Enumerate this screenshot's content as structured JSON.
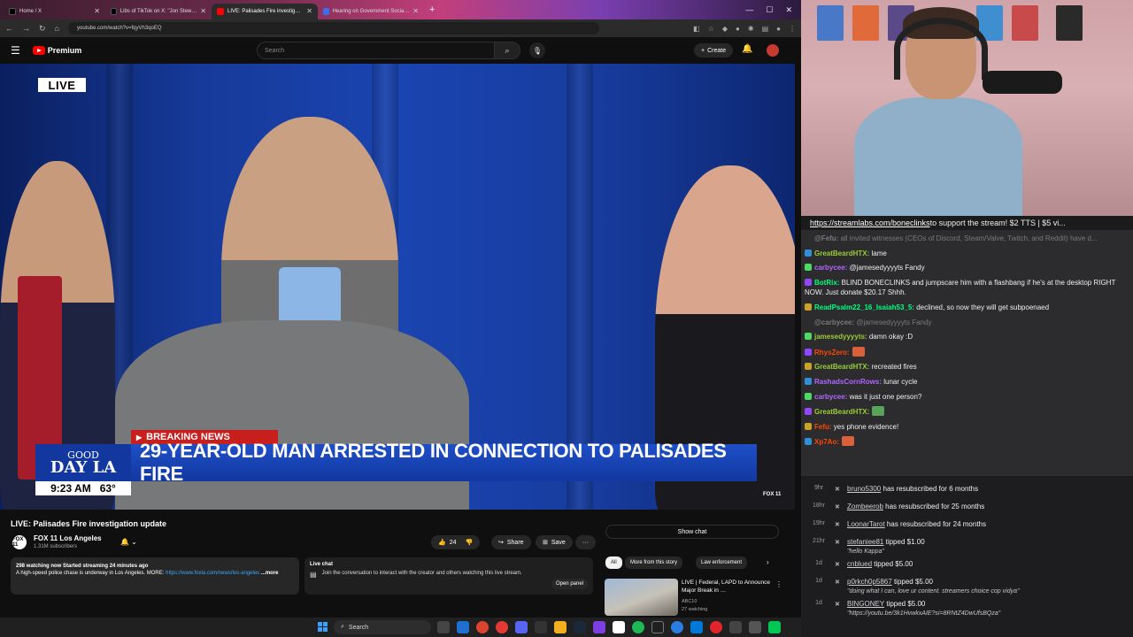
{
  "browser": {
    "tabs": [
      {
        "label": "Home / X"
      },
      {
        "label": "Libs of TikTok on X: \"Jon Stew…"
      },
      {
        "label": "LIVE: Palisades Fire investig…"
      },
      {
        "label": "Hearing on Government Socia…"
      }
    ],
    "url": "youtube.com/watch?v=fqyVh3qoEQ"
  },
  "youtube": {
    "logo": "Premium",
    "search_placeholder": "Search",
    "create_label": "Create",
    "video": {
      "live_badge": "LIVE",
      "breaking": "BREAKING NEWS",
      "headline": "29-YEAR-OLD MAN ARRESTED IN CONNECTION TO PALISADES FIRE",
      "show_line1": "GOOD",
      "show_line2": "DAY LA",
      "time": "9:23 AM",
      "temp": "63°",
      "bug": "FOX 11"
    },
    "title": "LIVE: Palisades Fire investigation update",
    "channel": {
      "name": "FOX 11 Los Angeles",
      "subs": "1.31M subscribers",
      "logo": "FOX 11"
    },
    "actions": {
      "likes": "24",
      "share": "Share",
      "save": "Save",
      "more": "···"
    },
    "description": {
      "stats": "298 watching now  Started streaming 24 minutes ago",
      "text": "A high-speed police chase is underway in Los Angeles. MORE:",
      "link": "https://www.foxla.com/news/los-angeles",
      "more": "...more"
    },
    "live_chat": {
      "header": "Live chat",
      "text": "Join the conversation to interact with the creator and others watching this live stream.",
      "open_panel": "Open panel"
    },
    "show_chat": "Show chat",
    "chips": [
      "All",
      "More from this story",
      "Law enforcement"
    ],
    "recommended": {
      "title": "LIVE | Federal, LAPD to Announce Major Break in …",
      "channel": "ABC10",
      "views": "27 watching"
    }
  },
  "taskbar": {
    "search": "Search"
  },
  "stream": {
    "link_text": "https://streamlabs.com/boneclinks",
    "link_rest": " to support the stream! $2 TTS | $5 vi..."
  },
  "chat": [
    {
      "user": "@Fefu:",
      "text": " all invited witnesses (CEOs of Discord, Steam/Valve, Twitch, and Reddit) have d...",
      "color": "#7a7a7e",
      "dim": true
    },
    {
      "user": "GreatBeardHTX:",
      "text": " lame",
      "color": "#9acd32"
    },
    {
      "user": "carbycee:",
      "text": " @jamesedyyyyts Fandy",
      "color": "#b066ff"
    },
    {
      "user": "BotRix:",
      "text": " BLIND BONECLINKS and jumpscare him with a flashbang if he's at the desktop RIGHT NOW. Just donate $20.17 Shhh.",
      "color": "#00ff7f"
    },
    {
      "user": "ReadPsalm22_16_Isaiah53_5:",
      "text": " declined, so now they will get subpoenaed",
      "color": "#00ff7f"
    },
    {
      "user": "@carbycee:",
      "text": " @jamesedyyyyts Fandy",
      "color": "#7a7a7e",
      "dim": true
    },
    {
      "user": "jamesedyyyyts:",
      "text": " damn okay :D",
      "color": "#9acd32"
    },
    {
      "user": "RhysZero:",
      "text": "",
      "color": "#ff4500"
    },
    {
      "user": "GreatBeardHTX:",
      "text": " recreated fires",
      "color": "#9acd32"
    },
    {
      "user": "RashadsCornRows:",
      "text": " lunar cycle",
      "color": "#b066ff"
    },
    {
      "user": "carbycee:",
      "text": " was it just one person?",
      "color": "#b066ff"
    },
    {
      "user": "GreatBeardHTX:",
      "text": "",
      "color": "#9acd32"
    },
    {
      "user": "Fefu:",
      "text": " yes phone evidence!",
      "color": "#ff4500"
    },
    {
      "user": "Xp7Ao:",
      "text": "",
      "color": "#ff4500"
    }
  ],
  "events": [
    {
      "age": "9hr",
      "user": "bruno5300",
      "action": " has resubscribed for 6 months",
      "note": ""
    },
    {
      "age": "18hr",
      "user": "Zombeerob",
      "action": " has resubscribed for 25 months",
      "note": ""
    },
    {
      "age": "19hr",
      "user": "LoonarTarot",
      "action": " has resubscribed for 24 months",
      "note": ""
    },
    {
      "age": "21hr",
      "user": "stefaniee81",
      "action": " tipped $1.00",
      "note": "\"hello Kappa\""
    },
    {
      "age": "1d",
      "user": "cnblued",
      "action": " tipped $5.00",
      "note": ""
    },
    {
      "age": "1d",
      "user": "p0rkch0p5867",
      "action": " tipped $5.00",
      "note": "\"doing what I can, love ur content. streamers choice cop vidya\""
    },
    {
      "age": "1d",
      "user": "BINGONEY",
      "action": " tipped $5.00",
      "note": "\"https://youtu.be/3k1HvwkxAIE?si=8RNtZ4DwUfsBQza\""
    }
  ]
}
